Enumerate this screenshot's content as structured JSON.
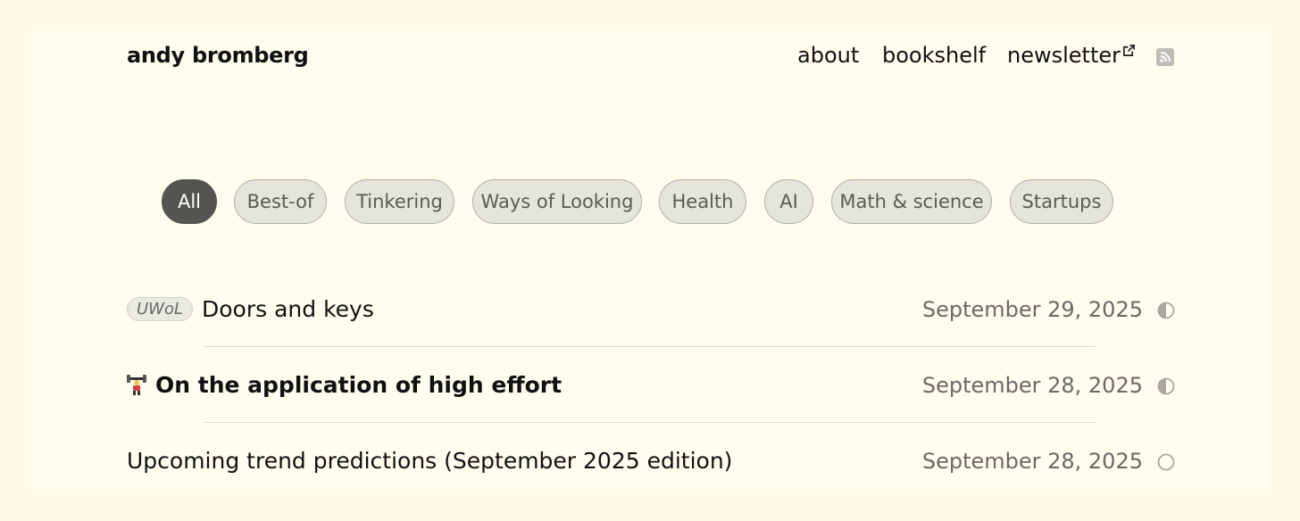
{
  "header": {
    "site_title": "andy bromberg",
    "nav": [
      {
        "label": "about"
      },
      {
        "label": "bookshelf"
      },
      {
        "label": "newsletter"
      }
    ]
  },
  "filters": {
    "items": [
      "All",
      "Best-of",
      "Tinkering",
      "Ways of Looking",
      "Health",
      "AI",
      "Math & science",
      "Startups"
    ],
    "active": "All"
  },
  "posts": [
    {
      "tag": "UWoL",
      "title": "Doors and keys",
      "date": "September 29, 2025",
      "status": "half-circle-icon"
    },
    {
      "emoji": "weightlifter-emoji",
      "title": "On the application of high effort",
      "date": "September 28, 2025",
      "status": "half-circle-icon"
    },
    {
      "title": "Upcoming trend predictions (September 2025 edition)",
      "date": "September 28, 2025",
      "status": "empty-circle-icon"
    }
  ],
  "colors": {
    "background": "#fdfbe9",
    "active_pill": "#545450",
    "pill": "#e6e5dc",
    "date_text": "#6a6a66"
  }
}
